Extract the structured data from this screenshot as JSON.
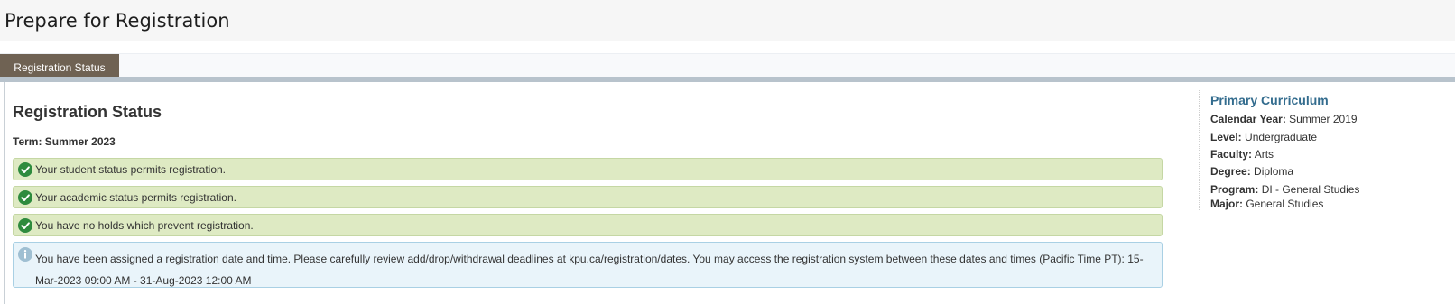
{
  "page": {
    "title": "Prepare for Registration"
  },
  "tabs": [
    {
      "label": "Registration Status"
    }
  ],
  "status": {
    "heading": "Registration Status",
    "term_label": "Term:",
    "term_value": "Summer 2023",
    "messages": [
      {
        "type": "success",
        "icon": "check-circle-icon",
        "text": "Your student status permits registration."
      },
      {
        "type": "success",
        "icon": "check-circle-icon",
        "text": "Your academic status permits registration."
      },
      {
        "type": "success",
        "icon": "check-circle-icon",
        "text": "You have no holds which prevent registration."
      },
      {
        "type": "info",
        "icon": "info-circle-icon",
        "text": "You have been assigned a registration date and time. Please carefully review add/drop/withdrawal deadlines at kpu.ca/registration/dates. You may access the registration system between these dates and times (Pacific Time PT): 15-Mar-2023 09:00 AM - 31-Aug-2023 12:00 AM"
      }
    ]
  },
  "curriculum": {
    "title": "Primary Curriculum",
    "fields": [
      {
        "label": "Calendar Year:",
        "value": "Summer 2019"
      },
      {
        "label": "Level:",
        "value": "Undergraduate"
      },
      {
        "label": "Faculty:",
        "value": "Arts"
      },
      {
        "label": "Degree:",
        "value": "Diploma"
      },
      {
        "label": "Program:",
        "value": "DI - General Studies"
      },
      {
        "label": "Major:",
        "value": "General Studies"
      }
    ]
  },
  "colors": {
    "tab_active": "#6f6253",
    "success_bg": "#deeac3",
    "success_icon": "#2e8b3e",
    "info_bg": "#e9f4fa",
    "info_icon": "#9fbfd2",
    "curriculum_title": "#336c8e"
  }
}
